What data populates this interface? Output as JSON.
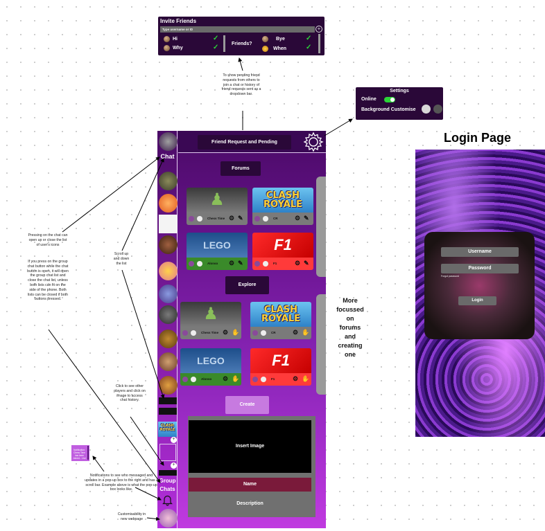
{
  "invite": {
    "title": "Invite Friends",
    "placeholder": "Type username or ID",
    "add": "+",
    "friends": [
      "Hi",
      "Why",
      "Friends?",
      "Bye",
      "When"
    ]
  },
  "notes": {
    "pending": "To show pending friend requests from others to join a chat or history of friend requests sent as a dropdown bar.",
    "chat_toggle": "Pressing on the chat can open up or close the list of user's icons",
    "group_toggle": "If you press on the group chat button while the chat button is open, it will open the group chat list and close the chat list, unless both lists can fit on the side of the phone. Both lists can be closed if both buttons pressed.",
    "scroll": "Scroll up and down the list",
    "click_players": "Click to see other players and click on image to access chat history.",
    "notifications": "Notifications to see who messaged and updates in a pop-up box to the right and has a scroll bar. Example above is what the pop-up box looks like.",
    "customisability": "Customisability in new webpage",
    "popup_example": "Notification: Chess Time has been Joined... Live",
    "more_focussed": "More focussed on forums and creating one"
  },
  "settings": {
    "title": "Settings",
    "online": "Online",
    "background": "Background Customise"
  },
  "phone": {
    "chat_label": "Chat",
    "group_label": "Group Chats",
    "friend_request": "Friend Request and Pending",
    "forums": "Forums",
    "explore": "Explore",
    "create": "Create",
    "insert_image": "Insert Image",
    "name": "Name",
    "description": "Description",
    "forum_cards": [
      {
        "label": "Chess Time",
        "art": "♟"
      },
      {
        "label": "CR",
        "art": "CLASH ROYALE"
      },
      {
        "label": "Alonso",
        "art": "LEGO"
      },
      {
        "label": "F1",
        "art": "F1"
      }
    ],
    "explore_cards": [
      {
        "label": "Chess Time",
        "art": "♟"
      },
      {
        "label": "CR",
        "art": "CLASH ROYALE"
      },
      {
        "label": "Alonso",
        "art": "LEGO"
      },
      {
        "label": "F1",
        "art": "F1"
      }
    ],
    "sidebar_cr": "CLASH ROYALE"
  },
  "login": {
    "title": "Login Page",
    "username": "Username",
    "password": "Password",
    "forgot": "Forgot password",
    "button": "Login"
  },
  "colors": {
    "panel": "#2a0838",
    "accent_green": "#2bd438",
    "phone_top": "#4a0a66",
    "phone_bottom": "#c03ae0"
  }
}
